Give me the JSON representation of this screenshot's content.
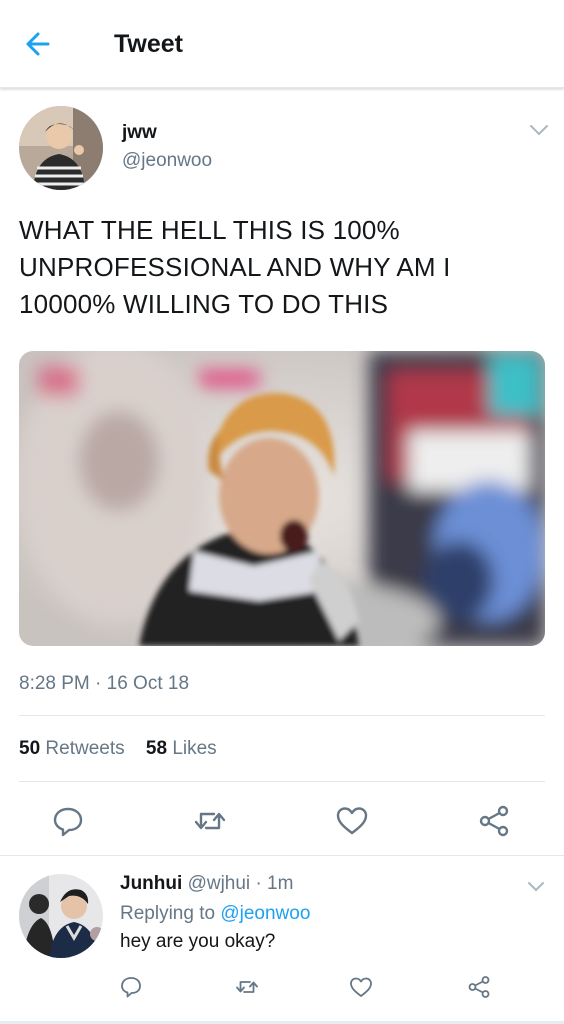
{
  "header": {
    "title": "Tweet",
    "back_icon": "arrow-left-icon",
    "accent": "#1da1f2"
  },
  "tweet": {
    "author_name": "jww",
    "author_handle": "@jeonwoo",
    "text": "WHAT THE HELL THIS IS 100% UNPROFESSIONAL AND WHY AM I 10000% WILLING TO DO THIS",
    "timestamp": "8:28 PM · 16 Oct 18",
    "retweets_count": "50",
    "retweets_label": "Retweets",
    "likes_count": "58",
    "likes_label": "Likes",
    "actions": [
      "reply-icon",
      "retweet-icon",
      "heart-icon",
      "share-icon"
    ]
  },
  "reply": {
    "author_name": "Junhui",
    "author_handle": "@wjhui",
    "separator": "·",
    "time": "1m",
    "replying_prefix": "Replying to",
    "replying_handle": "@jeonwoo",
    "text": "hey are you okay?",
    "actions": [
      "reply-icon",
      "retweet-icon",
      "heart-icon",
      "share-icon"
    ]
  },
  "colors": {
    "text_primary": "#14171a",
    "text_secondary": "#657786",
    "link": "#1da1f2",
    "divider": "#e1e8ed"
  }
}
